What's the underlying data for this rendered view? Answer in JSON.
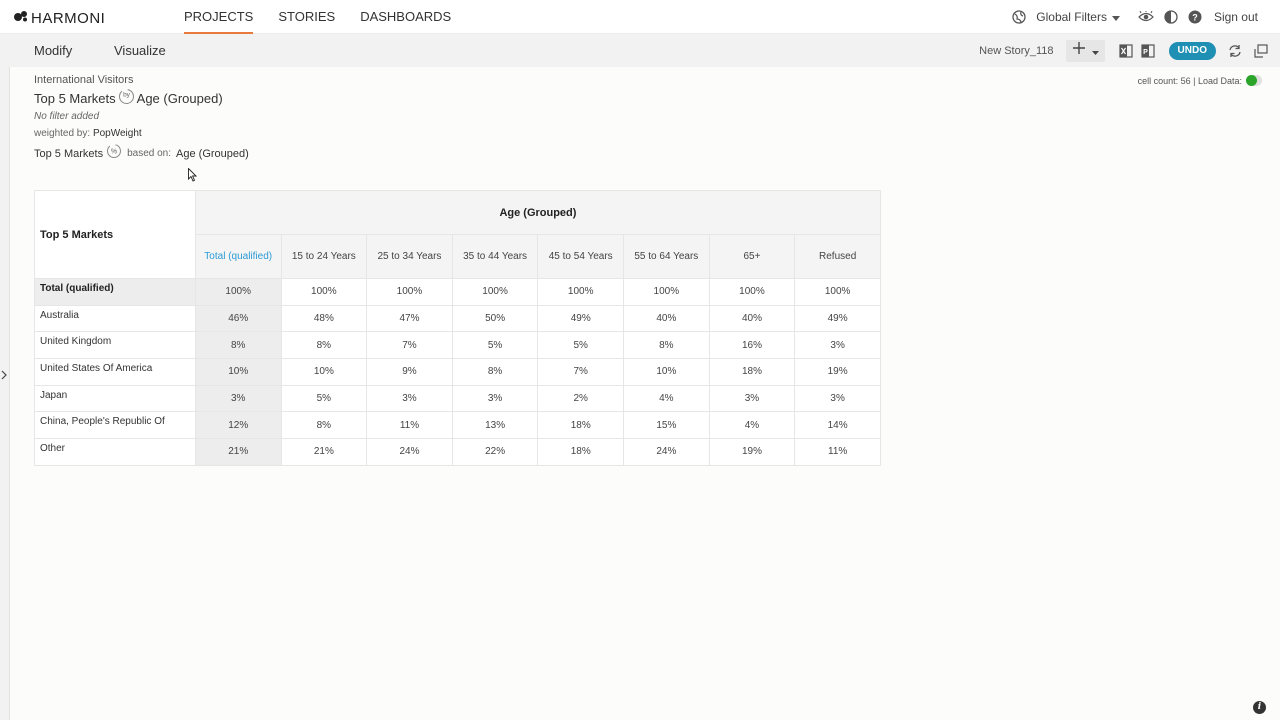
{
  "brand": {
    "name": "HARMONI"
  },
  "nav": {
    "tabs": [
      {
        "label": "PROJECTS",
        "active": true
      },
      {
        "label": "STORIES",
        "active": false
      },
      {
        "label": "DASHBOARDS",
        "active": false
      }
    ],
    "global_filters": "Global Filters",
    "sign_out": "Sign out"
  },
  "subbar": {
    "modify": "Modify",
    "visualize": "Visualize",
    "story_name": "New Story_118",
    "undo": "UNDO"
  },
  "meta": {
    "dataset": "International Visitors",
    "row_var": "Top 5 Markets",
    "col_var": "Age (Grouped)",
    "filter": "No filter added",
    "weight_label": "weighted by:",
    "weight_value": "PopWeight",
    "base_row": "Top 5 Markets",
    "based_on_label": "based on:",
    "based_on_value": "Age (Grouped)"
  },
  "cell_info": {
    "text": "cell count: 56 | Load Data:",
    "load_data_on": true
  },
  "table": {
    "corner": "Top 5 Markets",
    "group_header": "Age (Grouped)",
    "columns": [
      "Total (qualified)",
      "15 to 24 Years",
      "25 to 34 Years",
      "35 to 44 Years",
      "45 to 54 Years",
      "55 to 64 Years",
      "65+",
      "Refused"
    ],
    "rows": [
      {
        "label": "Total (qualified)",
        "values": [
          "100%",
          "100%",
          "100%",
          "100%",
          "100%",
          "100%",
          "100%",
          "100%"
        ]
      },
      {
        "label": "Australia",
        "values": [
          "46%",
          "48%",
          "47%",
          "50%",
          "49%",
          "40%",
          "40%",
          "49%"
        ]
      },
      {
        "label": "United Kingdom",
        "values": [
          "8%",
          "8%",
          "7%",
          "5%",
          "5%",
          "8%",
          "16%",
          "3%"
        ]
      },
      {
        "label": "United States Of America",
        "values": [
          "10%",
          "10%",
          "9%",
          "8%",
          "7%",
          "10%",
          "18%",
          "19%"
        ]
      },
      {
        "label": "Japan",
        "values": [
          "3%",
          "5%",
          "3%",
          "3%",
          "2%",
          "4%",
          "3%",
          "3%"
        ]
      },
      {
        "label": "China, People's Republic Of",
        "values": [
          "12%",
          "8%",
          "11%",
          "13%",
          "18%",
          "15%",
          "4%",
          "14%"
        ]
      },
      {
        "label": "Other",
        "values": [
          "21%",
          "21%",
          "24%",
          "22%",
          "18%",
          "24%",
          "19%",
          "11%"
        ]
      }
    ]
  },
  "colors": {
    "accent": "#e87a3e",
    "undo": "#1f8fb4",
    "link": "#2c9ad4",
    "load_on": "#2aa52a"
  }
}
